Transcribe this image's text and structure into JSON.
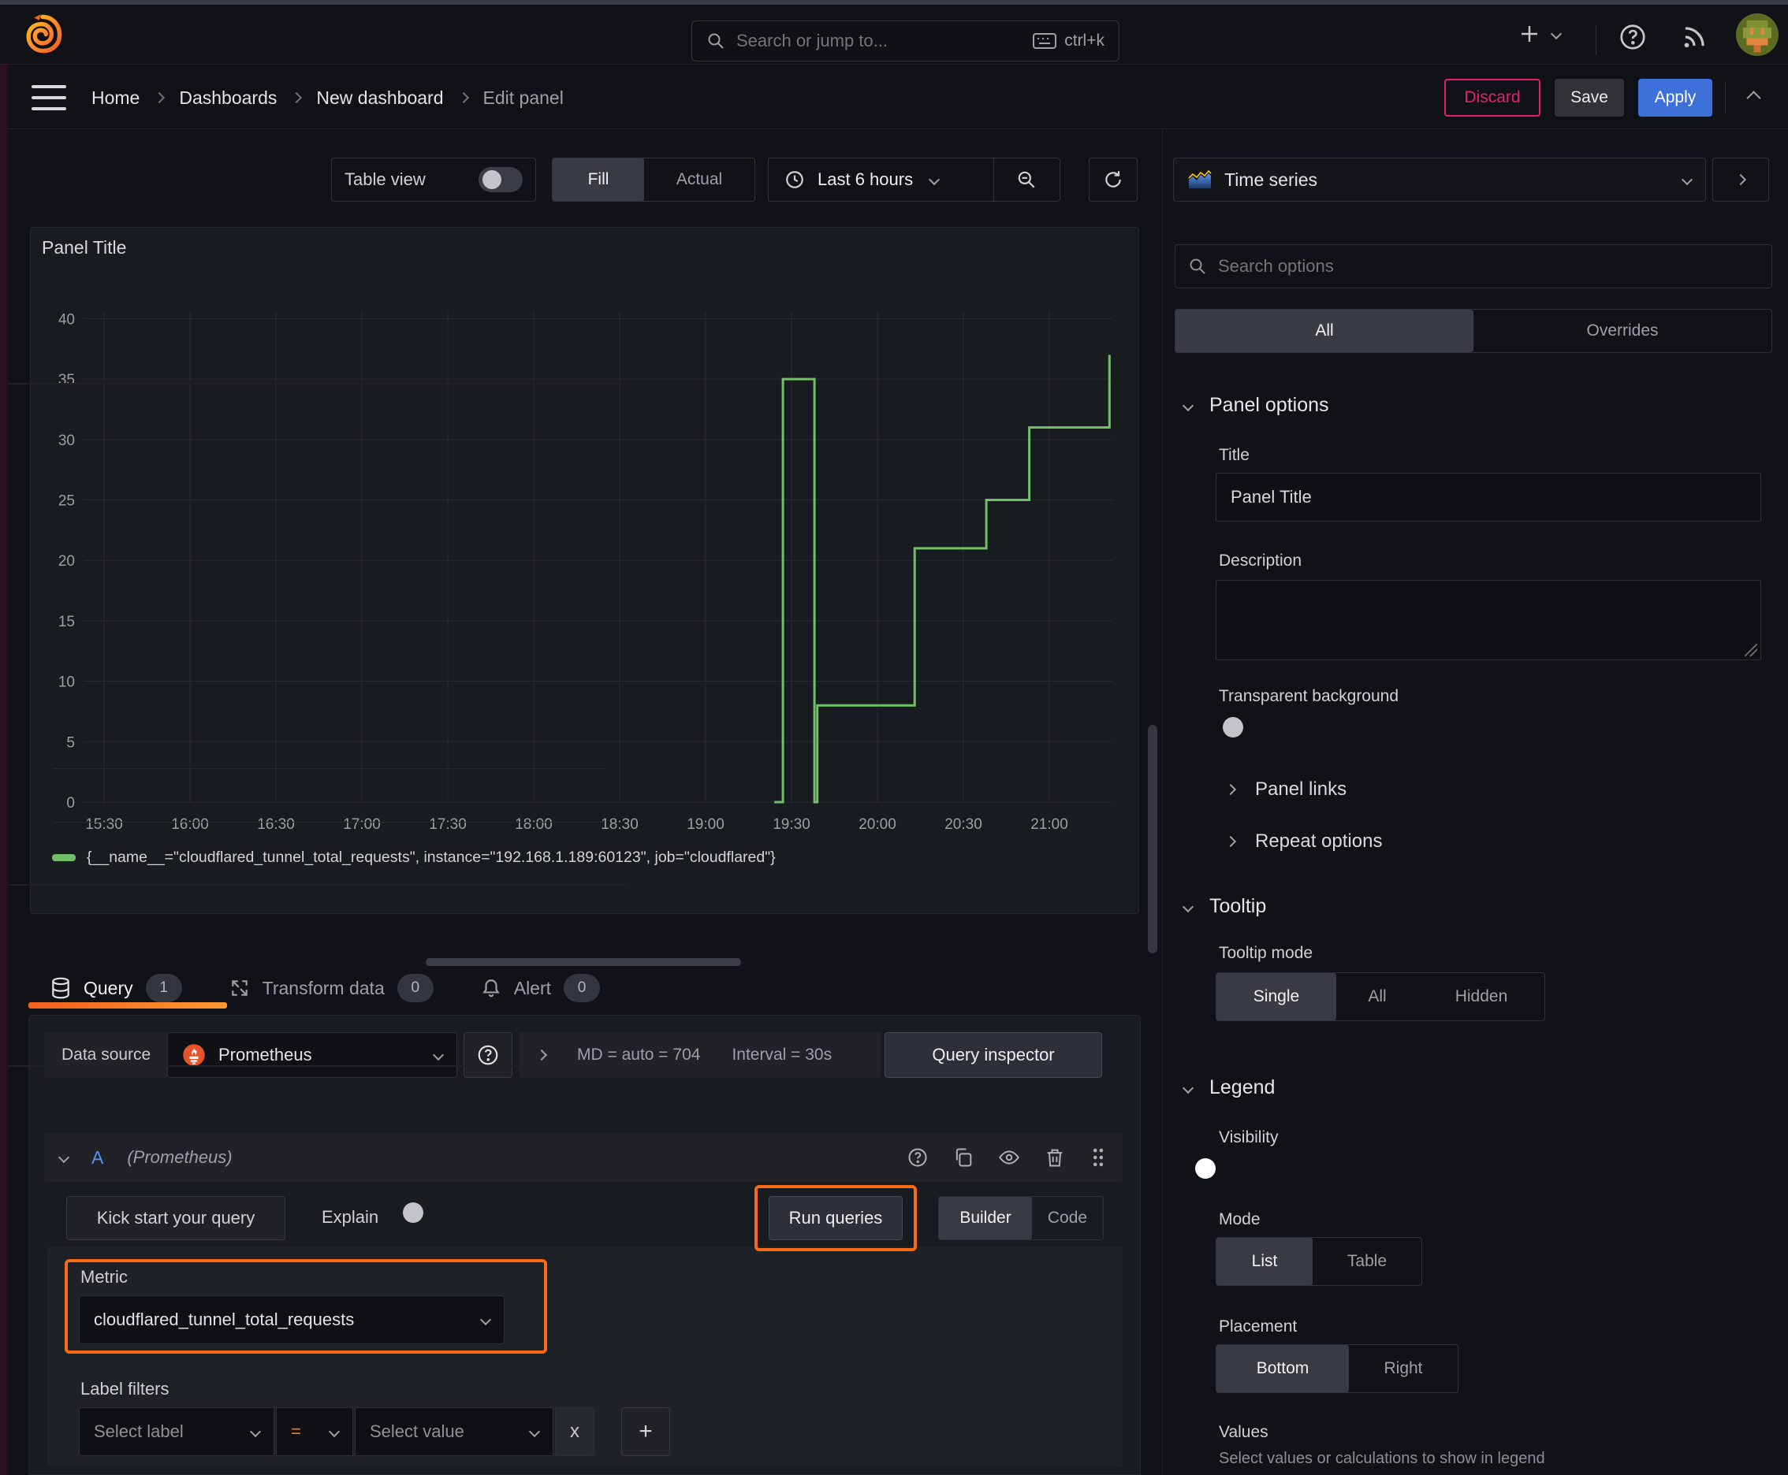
{
  "topbar": {
    "search_placeholder": "Search or jump to...",
    "shortcut": "ctrl+k"
  },
  "breadcrumb": {
    "items": [
      "Home",
      "Dashboards",
      "New dashboard",
      "Edit panel"
    ]
  },
  "actions": {
    "discard": "Discard",
    "save": "Save",
    "apply": "Apply"
  },
  "toolbar": {
    "table_view": "Table view",
    "fill": "Fill",
    "actual": "Actual",
    "time_range": "Last 6 hours"
  },
  "viz_picker": {
    "selected": "Time series"
  },
  "panel": {
    "title": "Panel Title"
  },
  "chart_data": {
    "type": "line",
    "line_interpolation": "step-after",
    "title": "Panel Title",
    "xlabel": "",
    "ylabel": "",
    "ylim": [
      0,
      40
    ],
    "grid": true,
    "legend_position": "bottom",
    "x_ticks": [
      "15:30",
      "16:00",
      "16:30",
      "17:00",
      "17:30",
      "18:00",
      "18:30",
      "19:00",
      "19:30",
      "20:00",
      "20:30",
      "21:00"
    ],
    "y_ticks": [
      0,
      5,
      10,
      15,
      20,
      25,
      30,
      35,
      40
    ],
    "series": [
      {
        "name": "{__name__=\"cloudflared_tunnel_total_requests\", instance=\"192.168.1.189:60123\", job=\"cloudflared\"}",
        "color": "#73BF69",
        "path": [
          [
            "19:24",
            0
          ],
          [
            "19:27",
            0
          ],
          [
            "19:27",
            35
          ],
          [
            "19:38",
            35
          ],
          [
            "19:38",
            0
          ],
          [
            "19:39",
            0
          ],
          [
            "19:39",
            8
          ],
          [
            "20:13",
            8
          ],
          [
            "20:13",
            21
          ],
          [
            "20:38",
            21
          ],
          [
            "20:38",
            25
          ],
          [
            "20:53",
            25
          ],
          [
            "20:53",
            31
          ],
          [
            "21:21",
            31
          ],
          [
            "21:21",
            37
          ]
        ]
      }
    ]
  },
  "query_section": {
    "tabs": [
      {
        "label": "Query",
        "badge": "1"
      },
      {
        "label": "Transform data",
        "badge": "0"
      },
      {
        "label": "Alert",
        "badge": "0"
      }
    ],
    "datasource_label": "Data source",
    "datasource": "Prometheus",
    "max_data_points": "MD = auto = 704",
    "interval": "Interval = 30s",
    "query_inspector": "Query inspector",
    "row": {
      "ref_id": "A",
      "ds_hint": "(Prometheus)"
    },
    "kick_start": "Kick start your query",
    "explain": "Explain",
    "run_queries": "Run queries",
    "builder": "Builder",
    "code": "Code",
    "metric_label": "Metric",
    "metric_value": "cloudflared_tunnel_total_requests",
    "label_filters_label": "Label filters",
    "select_label_placeholder": "Select label",
    "operator": "=",
    "select_value_placeholder": "Select value",
    "remove_filter": "x",
    "add_filter": "+"
  },
  "options_pane": {
    "search_placeholder": "Search options",
    "tabs": {
      "all": "All",
      "overrides": "Overrides"
    },
    "panel_options": {
      "header": "Panel options",
      "title_label": "Title",
      "title_value": "Panel Title",
      "description_label": "Description",
      "transparent_label": "Transparent background"
    },
    "collapsed_sections": [
      "Panel links",
      "Repeat options"
    ],
    "tooltip": {
      "header": "Tooltip",
      "mode_label": "Tooltip mode",
      "modes": [
        "Single",
        "All",
        "Hidden"
      ],
      "selected_mode": "Single"
    },
    "legend": {
      "header": "Legend",
      "visibility_label": "Visibility",
      "mode_label": "Mode",
      "modes": [
        "List",
        "Table"
      ],
      "selected_mode": "List",
      "placement_label": "Placement",
      "placements": [
        "Bottom",
        "Right"
      ],
      "selected_placement": "Bottom",
      "values_label": "Values",
      "values_help": "Select values or calculations to show in legend"
    }
  },
  "colors": {
    "highlight_orange": "#f96a13",
    "series_green": "#73BF69",
    "accent_blue": "#3d71d9",
    "discard_pink": "#e0226e",
    "prometheus_orange": "#e6522c"
  }
}
